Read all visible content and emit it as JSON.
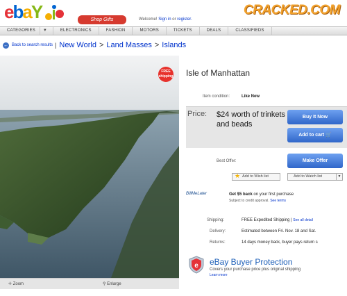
{
  "header": {
    "logo": {
      "e": "e",
      "b": "b",
      "a": "a",
      "y": "Y"
    },
    "shop_gifts": "Shop Gifts",
    "welcome": "Welcome!",
    "sign_in": "Sign in",
    "or": "or",
    "register": "register.",
    "cracked": "CRACKED.COM"
  },
  "nav": {
    "categories": "CATEGORIES",
    "items": [
      "ELECTRONICS",
      "FASHION",
      "MOTORS",
      "TICKETS",
      "DEALS",
      "CLASSIFIEDS"
    ]
  },
  "breadcrumb": {
    "back": "Back to search results",
    "crumbs": [
      "New World",
      "Land Masses",
      "Islands"
    ]
  },
  "image": {
    "free_shipping_line1": "FREE",
    "free_shipping_line2": "shipping",
    "zoom": "Zoom",
    "enlarge": "Enlarge"
  },
  "item": {
    "title": "Isle of Manhattan",
    "condition_label": "Item condition:",
    "condition_value": "Like New",
    "price_label": "Price:",
    "price_value": "$24 worth of trinkets and beads",
    "buy_now": "Buy It Now",
    "add_to_cart": "Add to cart",
    "best_offer_label": "Best Offer:",
    "make_offer": "Make Offer",
    "wish_list": "Add to Wish list",
    "watch_list": "Add to Watch list",
    "billme_logo": "BillMeLater",
    "billme_text_bold": "Get $5 back",
    "billme_text_rest": "on your first purchase",
    "billme_sub": "Subject to credit approval.",
    "billme_terms": "See terms",
    "shipping_label": "Shipping:",
    "shipping_value": "FREE Expedited Shipping |",
    "shipping_link": "See all detail",
    "delivery_label": "Delivery:",
    "delivery_value": "Estimated between Fri. Nov. 18 and Sat.",
    "returns_label": "Returns:",
    "returns_value": "14 days money back, buyer pays return s"
  },
  "protection": {
    "title": "eBay Buyer Protection",
    "desc": "Covers your purchase price plus original shipping",
    "learn_more": "Learn more"
  },
  "colors": {
    "ebay_red": "#e53238",
    "ebay_blue": "#0064d2",
    "ebay_yellow": "#f5af02",
    "ebay_green": "#86b817",
    "button_blue": "#2f66c9",
    "link_blue": "#0033cc",
    "cracked_orange": "#f2a12b"
  }
}
